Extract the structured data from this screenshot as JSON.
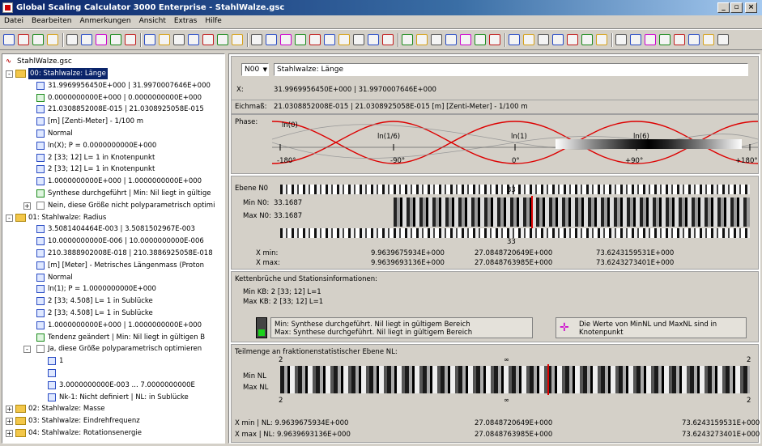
{
  "window": {
    "title": "Global Scaling Calculator 3000 Enterprise - StahlWalze.gsc",
    "min": "_",
    "max": "▫",
    "close": "×"
  },
  "menu": [
    "Datei",
    "Bearbeiten",
    "Anmerkungen",
    "Ansicht",
    "Extras",
    "Hilfe"
  ],
  "tree": {
    "root": "StahlWalze.gsc",
    "items": [
      {
        "text": "00: Stahlwalze: Länge",
        "kind": "folder",
        "indent": 0,
        "selected": true
      },
      {
        "text": "31.9969956450E+000 | 31.9970007646E+000",
        "indent": 1,
        "color": "b"
      },
      {
        "text": "0.0000000000E+000 | 0.0000000000E+000",
        "indent": 1,
        "color": "g"
      },
      {
        "text": "21.0308852008E-015 | 21.0308925058E-015",
        "indent": 1,
        "color": "b"
      },
      {
        "text": "[m] [Zenti-Meter] - 1/100 m",
        "indent": 1,
        "color": "b"
      },
      {
        "text": "Normal",
        "indent": 1,
        "color": "b"
      },
      {
        "text": "ln(X); P = 0.0000000000E+000",
        "indent": 1,
        "color": "b"
      },
      {
        "text": "2 [33; 12]  L= 1  in Knotenpunkt",
        "indent": 1,
        "color": "b"
      },
      {
        "text": "2 [33; 12]  L= 1  in Knotenpunkt",
        "indent": 1,
        "color": "b"
      },
      {
        "text": "1.0000000000E+000 | 1.0000000000E+000",
        "indent": 1,
        "color": "b"
      },
      {
        "text": "Synthese durchgeführt | Min: Nil liegt in gültige",
        "indent": 1,
        "color": "g"
      },
      {
        "text": "Nein, diese Größe nicht polyparametrisch optimi",
        "indent": 1,
        "color": "w",
        "pm": "+"
      },
      {
        "text": "01: Stahlwalze: Radius",
        "kind": "folder",
        "indent": 0
      },
      {
        "text": "3.5081404464E-003 | 3.5081502967E-003",
        "indent": 1,
        "color": "b"
      },
      {
        "text": "10.0000000000E-006 | 10.0000000000E-006",
        "indent": 1,
        "color": "b"
      },
      {
        "text": "210.3888902008E-018 | 210.3886925058E-018",
        "indent": 1,
        "color": "b"
      },
      {
        "text": "[m] [Meter] - Metrisches Längenmass (Proton",
        "indent": 1,
        "color": "b"
      },
      {
        "text": "Normal",
        "indent": 1,
        "color": "b"
      },
      {
        "text": "ln(1); P = 1.0000000000E+000",
        "indent": 1,
        "color": "b"
      },
      {
        "text": "2 [33; 4.508]  L= 1  in Sublücke",
        "indent": 1,
        "color": "b"
      },
      {
        "text": "2 [33; 4.508]  L= 1  in Sublücke",
        "indent": 1,
        "color": "b"
      },
      {
        "text": "1.0000000000E+000 | 1.0000000000E+000",
        "indent": 1,
        "color": "b"
      },
      {
        "text": "Tendenz geändert | Min: Nil liegt in gültigen B",
        "indent": 1,
        "color": "g"
      },
      {
        "text": "Ja, diese Größe polyparametrisch optimieren",
        "indent": 1,
        "color": "w",
        "pm": "-"
      },
      {
        "text": "1",
        "indent": 2,
        "color": "b"
      },
      {
        "text": "",
        "indent": 2,
        "color": "b"
      },
      {
        "text": "3.0000000000E-003 ... 7.0000000000E",
        "indent": 2,
        "color": "b"
      },
      {
        "text": "Nk-1: Nicht definiert | NL: in Sublücke",
        "indent": 2,
        "color": "b"
      },
      {
        "text": "02: Stahlwalze: Masse",
        "kind": "folder",
        "indent": 0,
        "pm": "+"
      },
      {
        "text": "03: Stahlwalze: Eindrehfrequenz",
        "kind": "folder",
        "indent": 0,
        "pm": "+"
      },
      {
        "text": "04: Stahlwalze: Rotationsenergie",
        "kind": "folder",
        "indent": 0,
        "pm": "+"
      }
    ]
  },
  "detail": {
    "selector": "N00",
    "name": "Stahlwalze: Länge",
    "x_label": "X:",
    "x_value": "31.9969956450E+000 | 31.9970007646E+000",
    "eich_label": "Eichmaß:",
    "eich_value": "21.0308852008E-015 | 21.0308925058E-015   [m] [Zenti-Meter] - 1/100 m",
    "phase_label": "Phase:",
    "phase_marks": [
      "ln(0)",
      "ln(1/6)",
      "ln(1)",
      "ln(6)"
    ],
    "phase_ticks": [
      "-180°",
      "-90°",
      "0°",
      "+90°",
      "+180°"
    ],
    "ebene_label": "Ebene N0",
    "min_label": "Min N0:",
    "min_val": "33.1687",
    "max_label": "Max N0:",
    "max_val": "33.1687",
    "num_top": "33",
    "num_bottom": "33",
    "xmin_label": "X min:",
    "xmax_label": "X max:",
    "xmin_vals": [
      "9.9639675934E+000",
      "27.0848720649E+000",
      "73.6243159531E+000"
    ],
    "xmax_vals": [
      "9.9639693136E+000",
      "27.0848763985E+000",
      "73.6243273401E+000"
    ],
    "kette_title": "Kettenbrüche und Stationsinformationen:",
    "kette_min": "Min KB:  2 [33; 12]  L=1",
    "kette_max": "Max KB:  2 [33; 12]  L=1",
    "syn_min": "Min:  Synthese durchgeführt.  Nil liegt in gültigem Bereich",
    "syn_max": "Max: Synthese durchgeführt.  Nil liegt in gültigem Bereich",
    "note": "Die Werte von MinNL und MaxNL sind in Knotenpunkt",
    "teil_title": "Teilmenge an fraktionenstatistischer Ebene NL:",
    "teil_top": [
      "2",
      "∞",
      "2"
    ],
    "teil_bot": [
      "2",
      "∞",
      "2"
    ],
    "minnl_label": "Min NL",
    "maxnl_label": "Max NL",
    "xminnl": "X min | NL:  9.9639675934E+000",
    "xmaxnl": "X max | NL:  9.9639693136E+000",
    "xminnl_mid": "27.0848720649E+000",
    "xmaxnl_mid": "27.0848763985E+000",
    "xminnl_right": "73.6243159531E+000",
    "xmaxnl_right": "73.6243273401E+000"
  }
}
